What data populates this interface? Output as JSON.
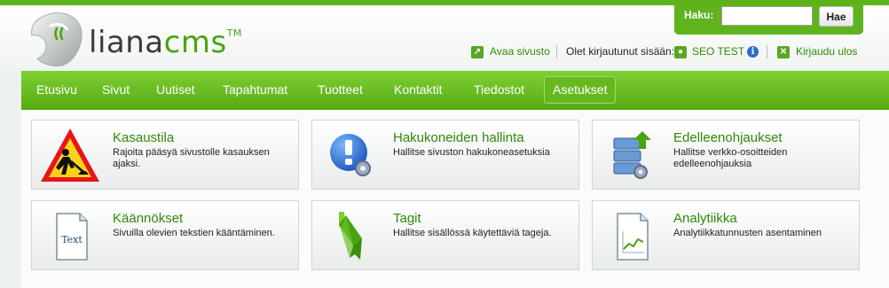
{
  "brand": {
    "name_part1": "liana",
    "name_part2": "cms",
    "trademark": "TM"
  },
  "search": {
    "label": "Haku:",
    "value": "",
    "placeholder": "",
    "button_label": "Hae"
  },
  "userbar": {
    "open_site_label": "Avaa sivusto",
    "logged_in_prefix": "Olet kirjautunut sisään:",
    "user_name": "SEO TEST",
    "logout_label": "Kirjaudu ulos"
  },
  "nav": {
    "items": [
      {
        "label": "Etusivu"
      },
      {
        "label": "Sivut"
      },
      {
        "label": "Uutiset"
      },
      {
        "label": "Tapahtumat"
      },
      {
        "label": "Tuotteet"
      },
      {
        "label": "Kontaktit"
      },
      {
        "label": "Tiedostot"
      },
      {
        "label": "Asetukset"
      }
    ],
    "active_label": "Asetukset"
  },
  "tiles": [
    {
      "title": "Kasaustila",
      "description": "Rajoita pääsyä sivustolle kasauksen ajaksi.",
      "icon": "construction-sign-icon"
    },
    {
      "title": "Hakukoneiden hallinta",
      "description": "Hallitse sivuston hakukoneasetuksia",
      "icon": "search-engine-settings-icon"
    },
    {
      "title": "Edelleenohjaukset",
      "description": "Hallitse verkko-osoitteiden edelleenohjauksia",
      "icon": "redirect-server-icon"
    },
    {
      "title": "Käännökset",
      "description": "Sivuilla olevien tekstien kääntäminen.",
      "icon": "text-document-icon",
      "icon_text": "Text"
    },
    {
      "title": "Tagit",
      "description": "Hallitse sisällössä käytettäviä tageja.",
      "icon": "tag-ribbon-icon"
    },
    {
      "title": "Analytiikka",
      "description": "Analytiikkatunnusten asentaminen",
      "icon": "analytics-chart-icon"
    }
  ],
  "colors": {
    "accent": "#5bb318",
    "link": "#2f8b07"
  }
}
